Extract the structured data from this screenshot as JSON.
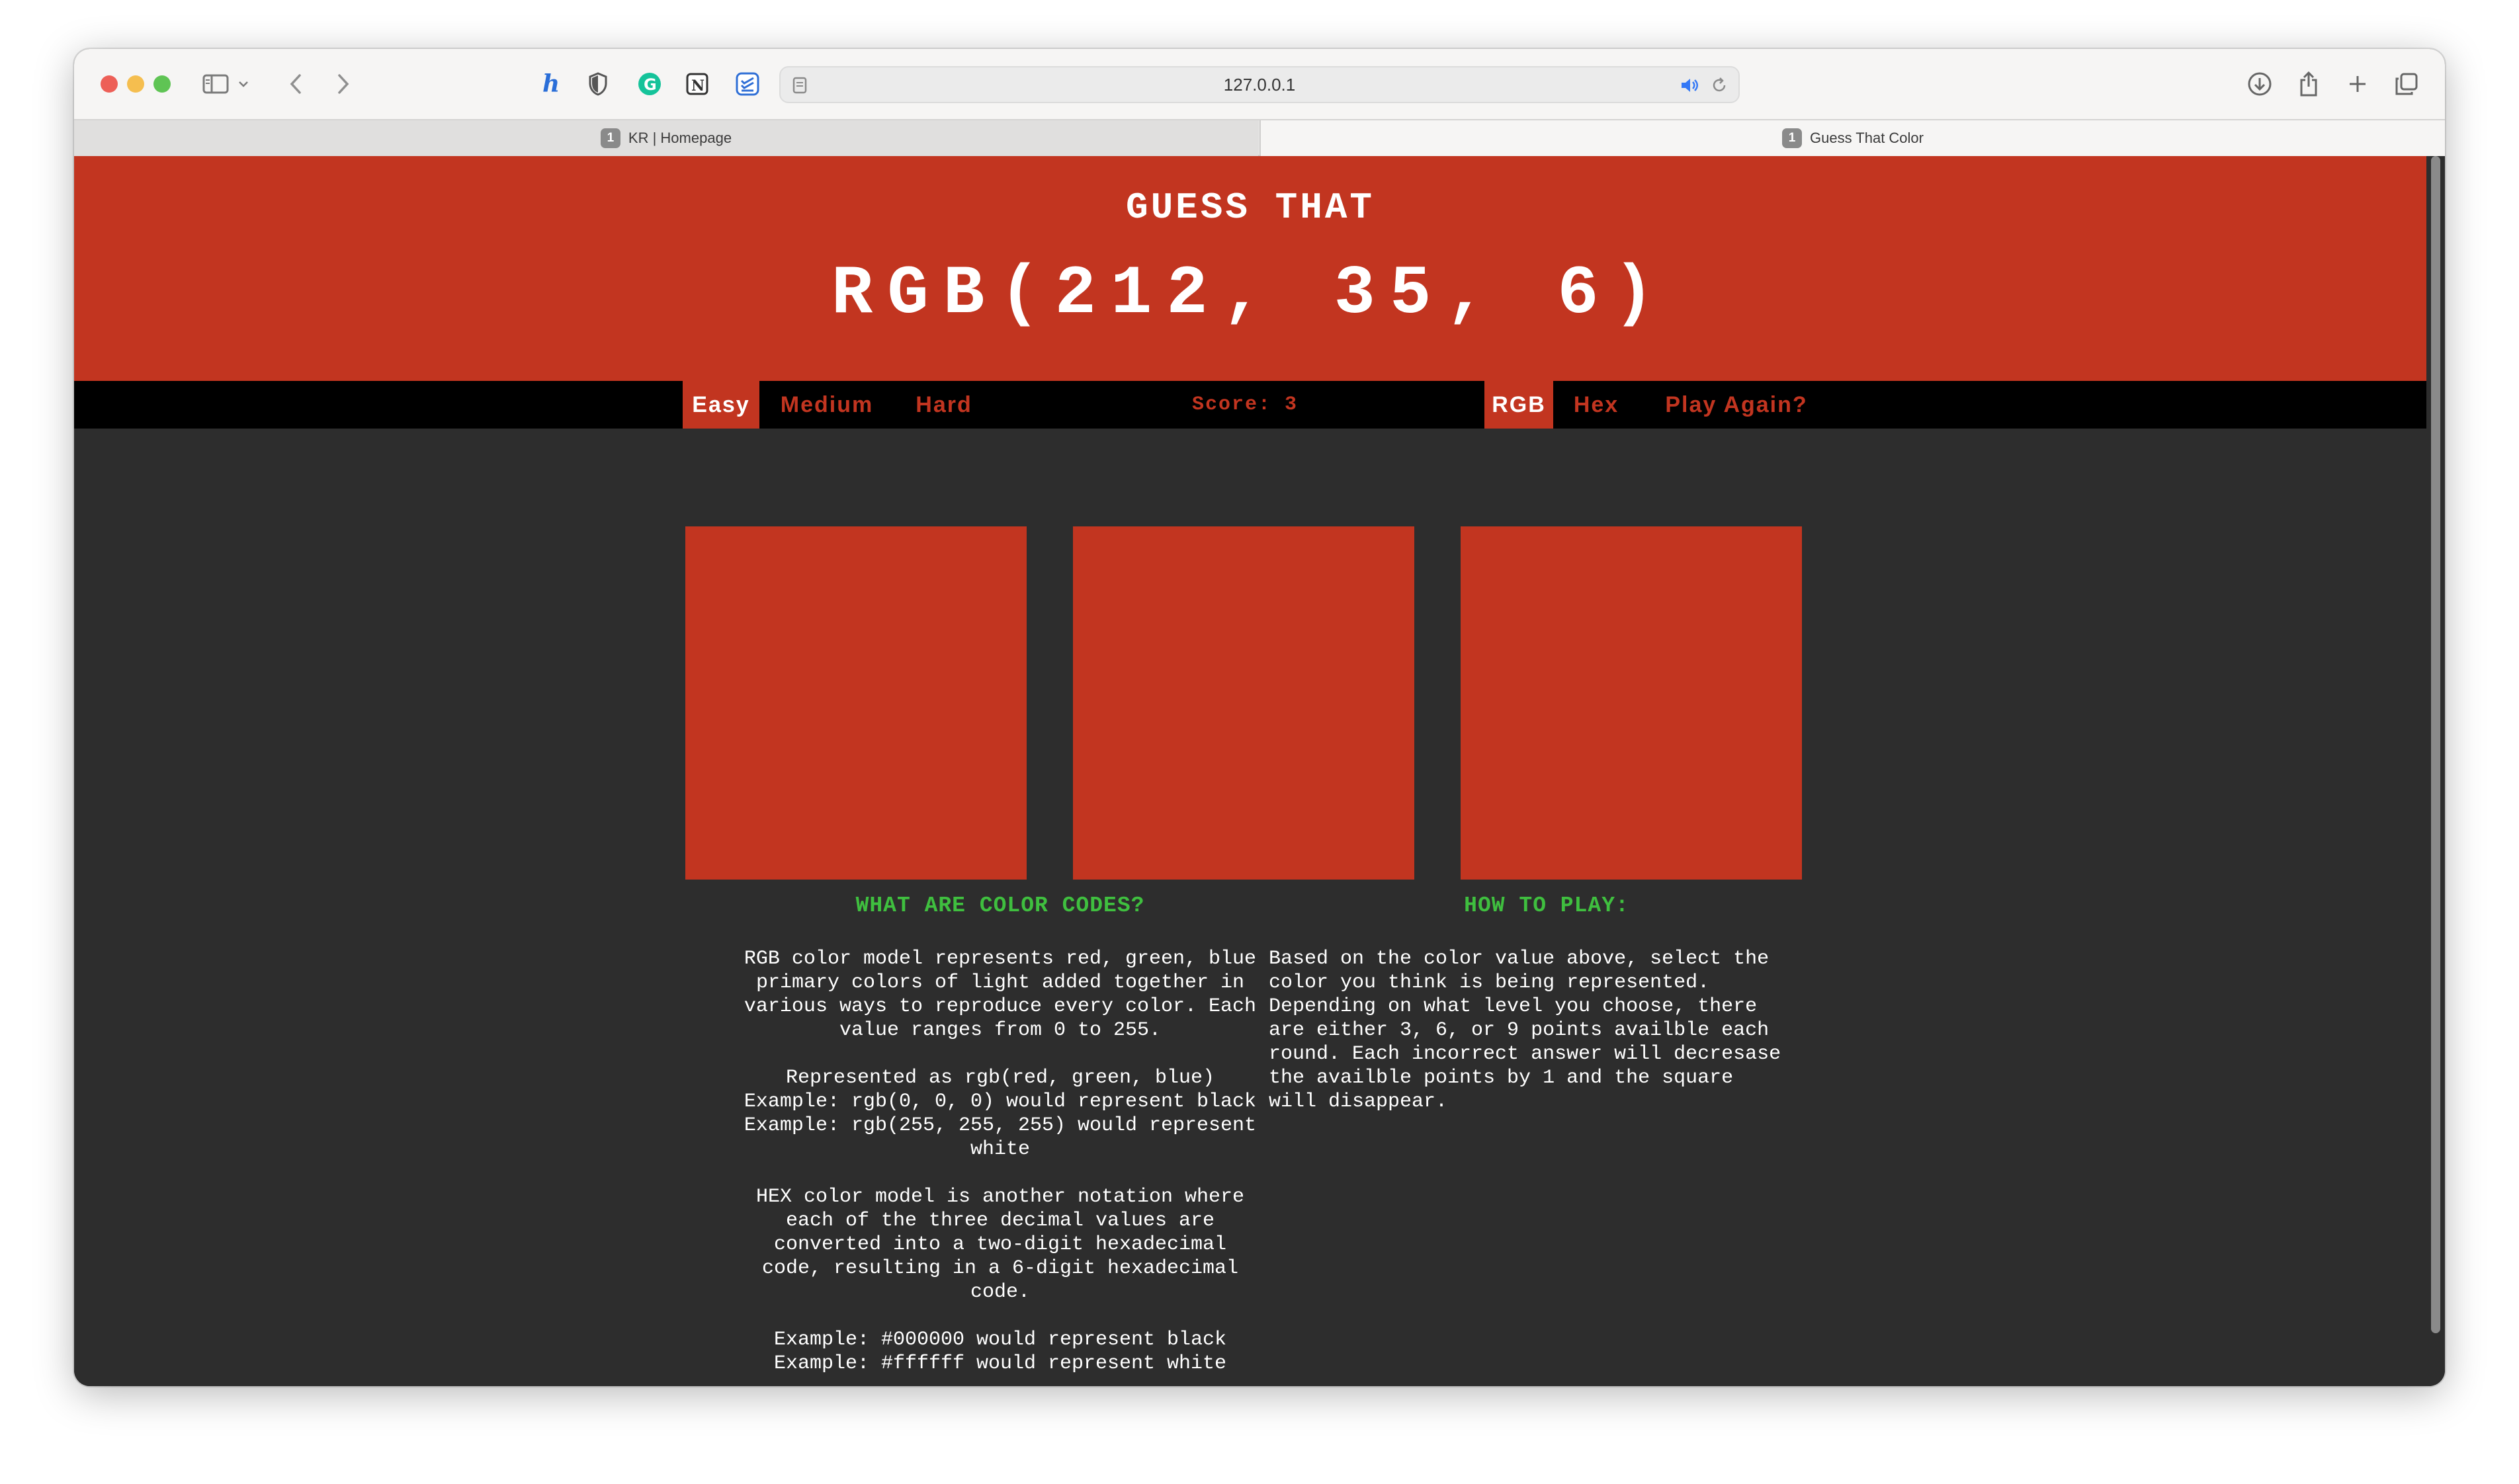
{
  "browser": {
    "url": "127.0.0.1",
    "tabs": [
      {
        "badge": "1",
        "label": "KR | Homepage"
      },
      {
        "badge": "1",
        "label": "Guess That Color"
      }
    ],
    "icons": [
      "sidebar-icon",
      "chevron-down-icon",
      "back-icon",
      "forward-icon",
      "extension-h-icon",
      "shield-icon",
      "grammarly-icon",
      "notion-icon",
      "todoist-icon",
      "page-icon",
      "speaker-icon",
      "reload-icon",
      "download-icon",
      "share-icon",
      "new-tab-icon",
      "tab-overview-icon"
    ]
  },
  "header": {
    "guess_line": "GUESS THAT",
    "color_value": "RGB(212, 35, 6)",
    "background": "#c23520"
  },
  "nav": {
    "easy": "Easy",
    "medium": "Medium",
    "hard": "Hard",
    "score": "Score: 3",
    "rgb": "RGB",
    "hex": "Hex",
    "play_again": "Play Again?",
    "active_difficulty": "Easy",
    "active_mode": "RGB"
  },
  "squares": [
    {
      "color": "#c23520"
    },
    {
      "color": "#c23520"
    },
    {
      "color": "#c23520"
    }
  ],
  "info": {
    "left_title": "WHAT ARE COLOR CODES?",
    "left_p1": "RGB color model represents red, green, blue\nprimary colors of light added together in\nvarious ways to reproduce every color. Each\nvalue ranges from 0 to 255.",
    "left_p2": "Represented as rgb(red, green, blue)\nExample: rgb(0, 0, 0) would represent black\nExample: rgb(255, 255, 255) would represent\nwhite",
    "left_p3": "HEX color model is another notation where\neach of the three decimal values are\nconverted into a two-digit hexadecimal\ncode, resulting in a 6-digit hexadecimal\ncode.",
    "left_p4": "Example: #000000 would represent black\nExample: #ffffff would represent white",
    "right_title": "HOW TO PLAY:",
    "right_p1": "Based on the color value above, select the\ncolor you think is being represented.\nDepending on what level you choose, there\nare either 3, 6, or 9 points availble each\nround. Each incorrect answer will decresase\nthe availble points by 1 and the square\nwill disappear."
  },
  "colors": {
    "accent_red": "#c23520",
    "title_green": "#3fbf3f",
    "page_bg": "#2d2d2d"
  }
}
